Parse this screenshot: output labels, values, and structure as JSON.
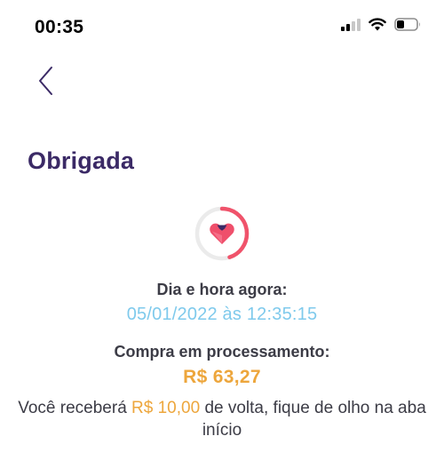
{
  "status_bar": {
    "time": "00:35",
    "icons": [
      "signal-icon",
      "wifi-icon",
      "battery-icon"
    ]
  },
  "navigation": {
    "back_icon": "chevron-left-icon"
  },
  "title": "Obrigada",
  "progress": {
    "icon": "heart-gem-icon",
    "fraction": 0.45,
    "colors": {
      "track": "#ebebeb",
      "fill": "#f0536b"
    }
  },
  "now_label": "Dia e hora agora:",
  "datetime": "05/01/2022 às 12:35:15",
  "purchase_label": "Compra em processamento:",
  "amount": "R$ 63,27",
  "cashback": {
    "prefix": "Você receberá ",
    "value": "R$ 10,00",
    "suffix": " de volta, fique de olho na aba início"
  },
  "colors": {
    "title": "#3b2a66",
    "datetime": "#7fcaec",
    "amount": "#eda63c",
    "text": "#3c3c46"
  }
}
